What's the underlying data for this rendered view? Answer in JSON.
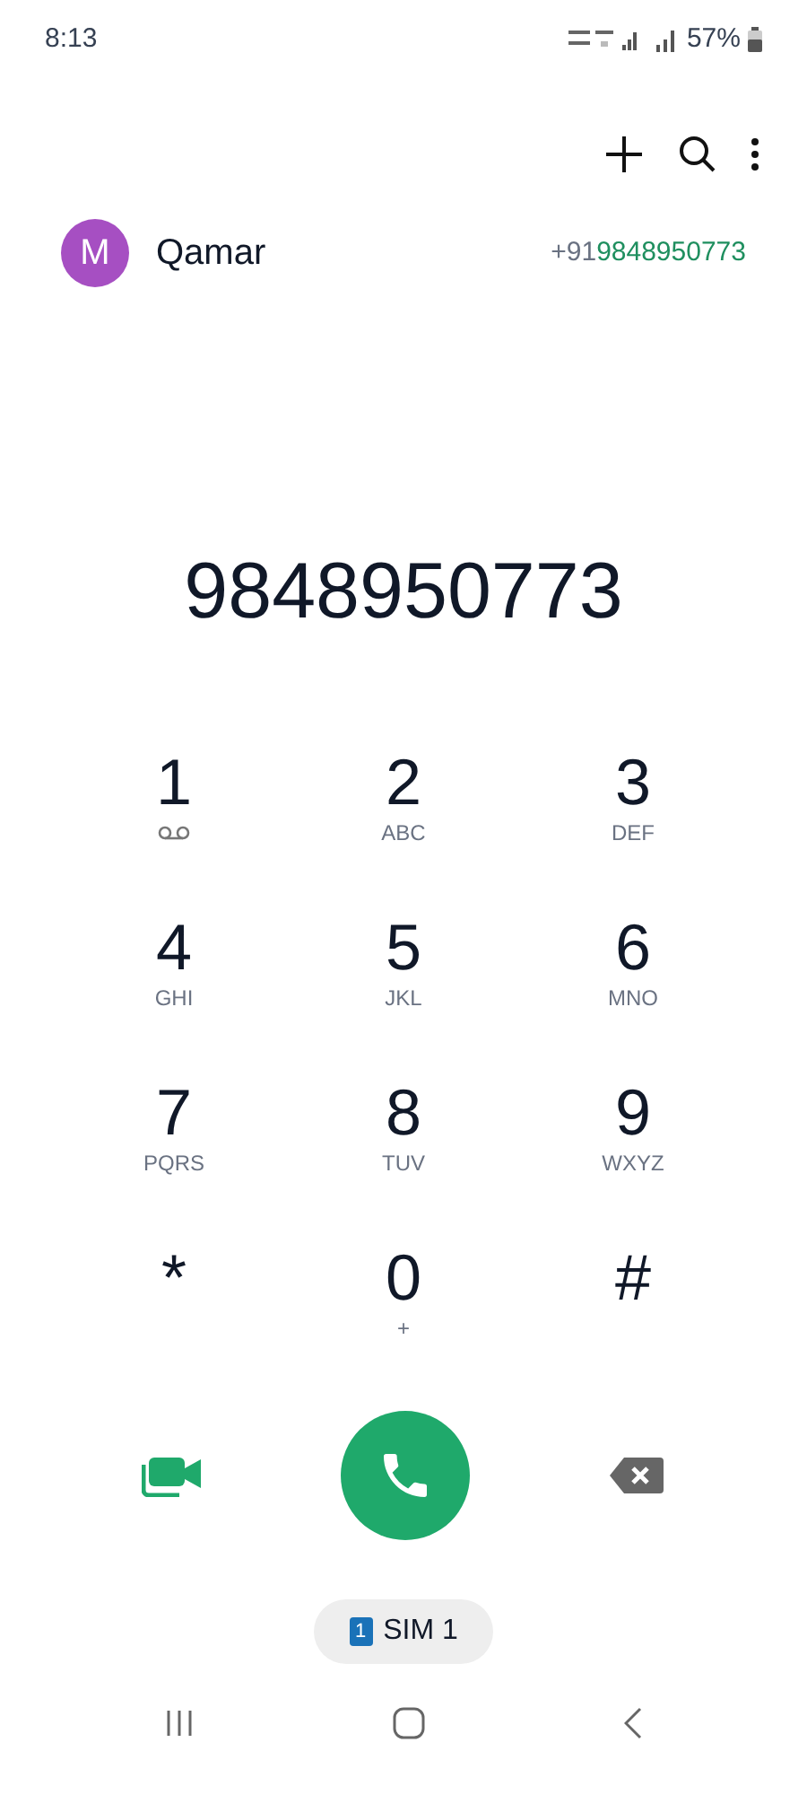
{
  "status_bar": {
    "time": "8:13",
    "battery": "57%"
  },
  "contact": {
    "initial": "M",
    "name": "Qamar",
    "color": "#a64fc2",
    "number_prefix": "+91",
    "number_match": "9848950773"
  },
  "dialed_number": "9848950773",
  "keys": [
    {
      "digit": "1",
      "kind": "voicemail"
    },
    {
      "digit": "2",
      "kind": "letters",
      "sub": "ABC"
    },
    {
      "digit": "3",
      "kind": "letters",
      "sub": "DEF"
    },
    {
      "digit": "4",
      "kind": "letters",
      "sub": "GHI"
    },
    {
      "digit": "5",
      "kind": "letters",
      "sub": "JKL"
    },
    {
      "digit": "6",
      "kind": "letters",
      "sub": "MNO"
    },
    {
      "digit": "7",
      "kind": "letters",
      "sub": "PQRS"
    },
    {
      "digit": "8",
      "kind": "letters",
      "sub": "TUV"
    },
    {
      "digit": "9",
      "kind": "letters",
      "sub": "WXYZ"
    },
    {
      "digit": "*",
      "kind": "plain"
    },
    {
      "digit": "0",
      "kind": "letters",
      "sub": "+"
    },
    {
      "digit": "#",
      "kind": "plain"
    }
  ],
  "sim": {
    "badge": "1",
    "label": "SIM 1"
  }
}
